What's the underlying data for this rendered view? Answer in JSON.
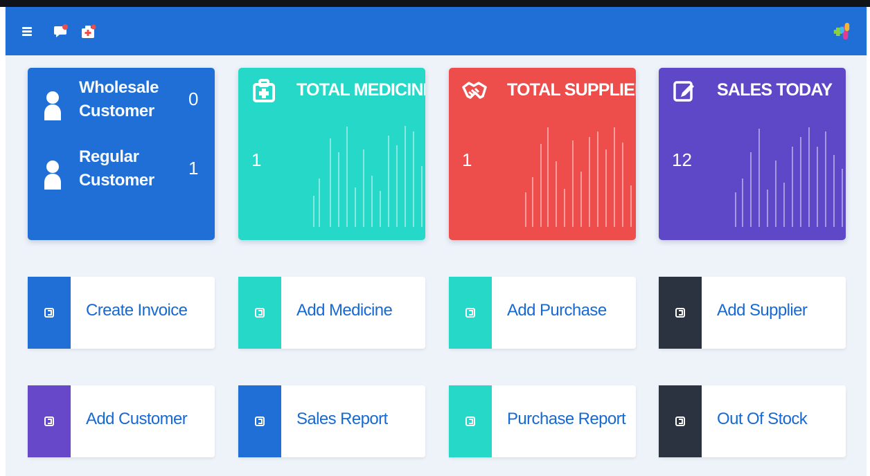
{
  "header": {
    "icons": [
      "menu-icon",
      "chat-icon",
      "first-aid-kit-icon",
      "medical-brand-icon"
    ],
    "bar_color": "#1f6fd6"
  },
  "stats": {
    "customers": {
      "wholesale_label": "Wholesale Customer",
      "wholesale_count": "0",
      "regular_label": "Regular Customer",
      "regular_count": "1",
      "color": "#1f6fd6"
    },
    "medicine": {
      "title": "TOTAL MEDICINE",
      "value": "1",
      "color": "#26d8c8"
    },
    "supplier": {
      "title": "TOTAL SUPPLIER",
      "value": "1",
      "color": "#ed4e4b"
    },
    "sales": {
      "title": "SALES TODAY",
      "value": "12",
      "color": "#5e48c7"
    }
  },
  "actions": [
    {
      "label": "Create Invoice",
      "color": "#1f6fd6"
    },
    {
      "label": "Add Medicine",
      "color": "#26d8c8"
    },
    {
      "label": "Add Purchase",
      "color": "#26d8c8"
    },
    {
      "label": "Add Supplier",
      "color": "#2b3240"
    },
    {
      "label": "Add Customer",
      "color": "#6648c8"
    },
    {
      "label": "Sales Report",
      "color": "#1f6fd6"
    },
    {
      "label": "Purchase Report",
      "color": "#26d8c8"
    },
    {
      "label": "Out Of Stock",
      "color": "#2b3240"
    }
  ]
}
